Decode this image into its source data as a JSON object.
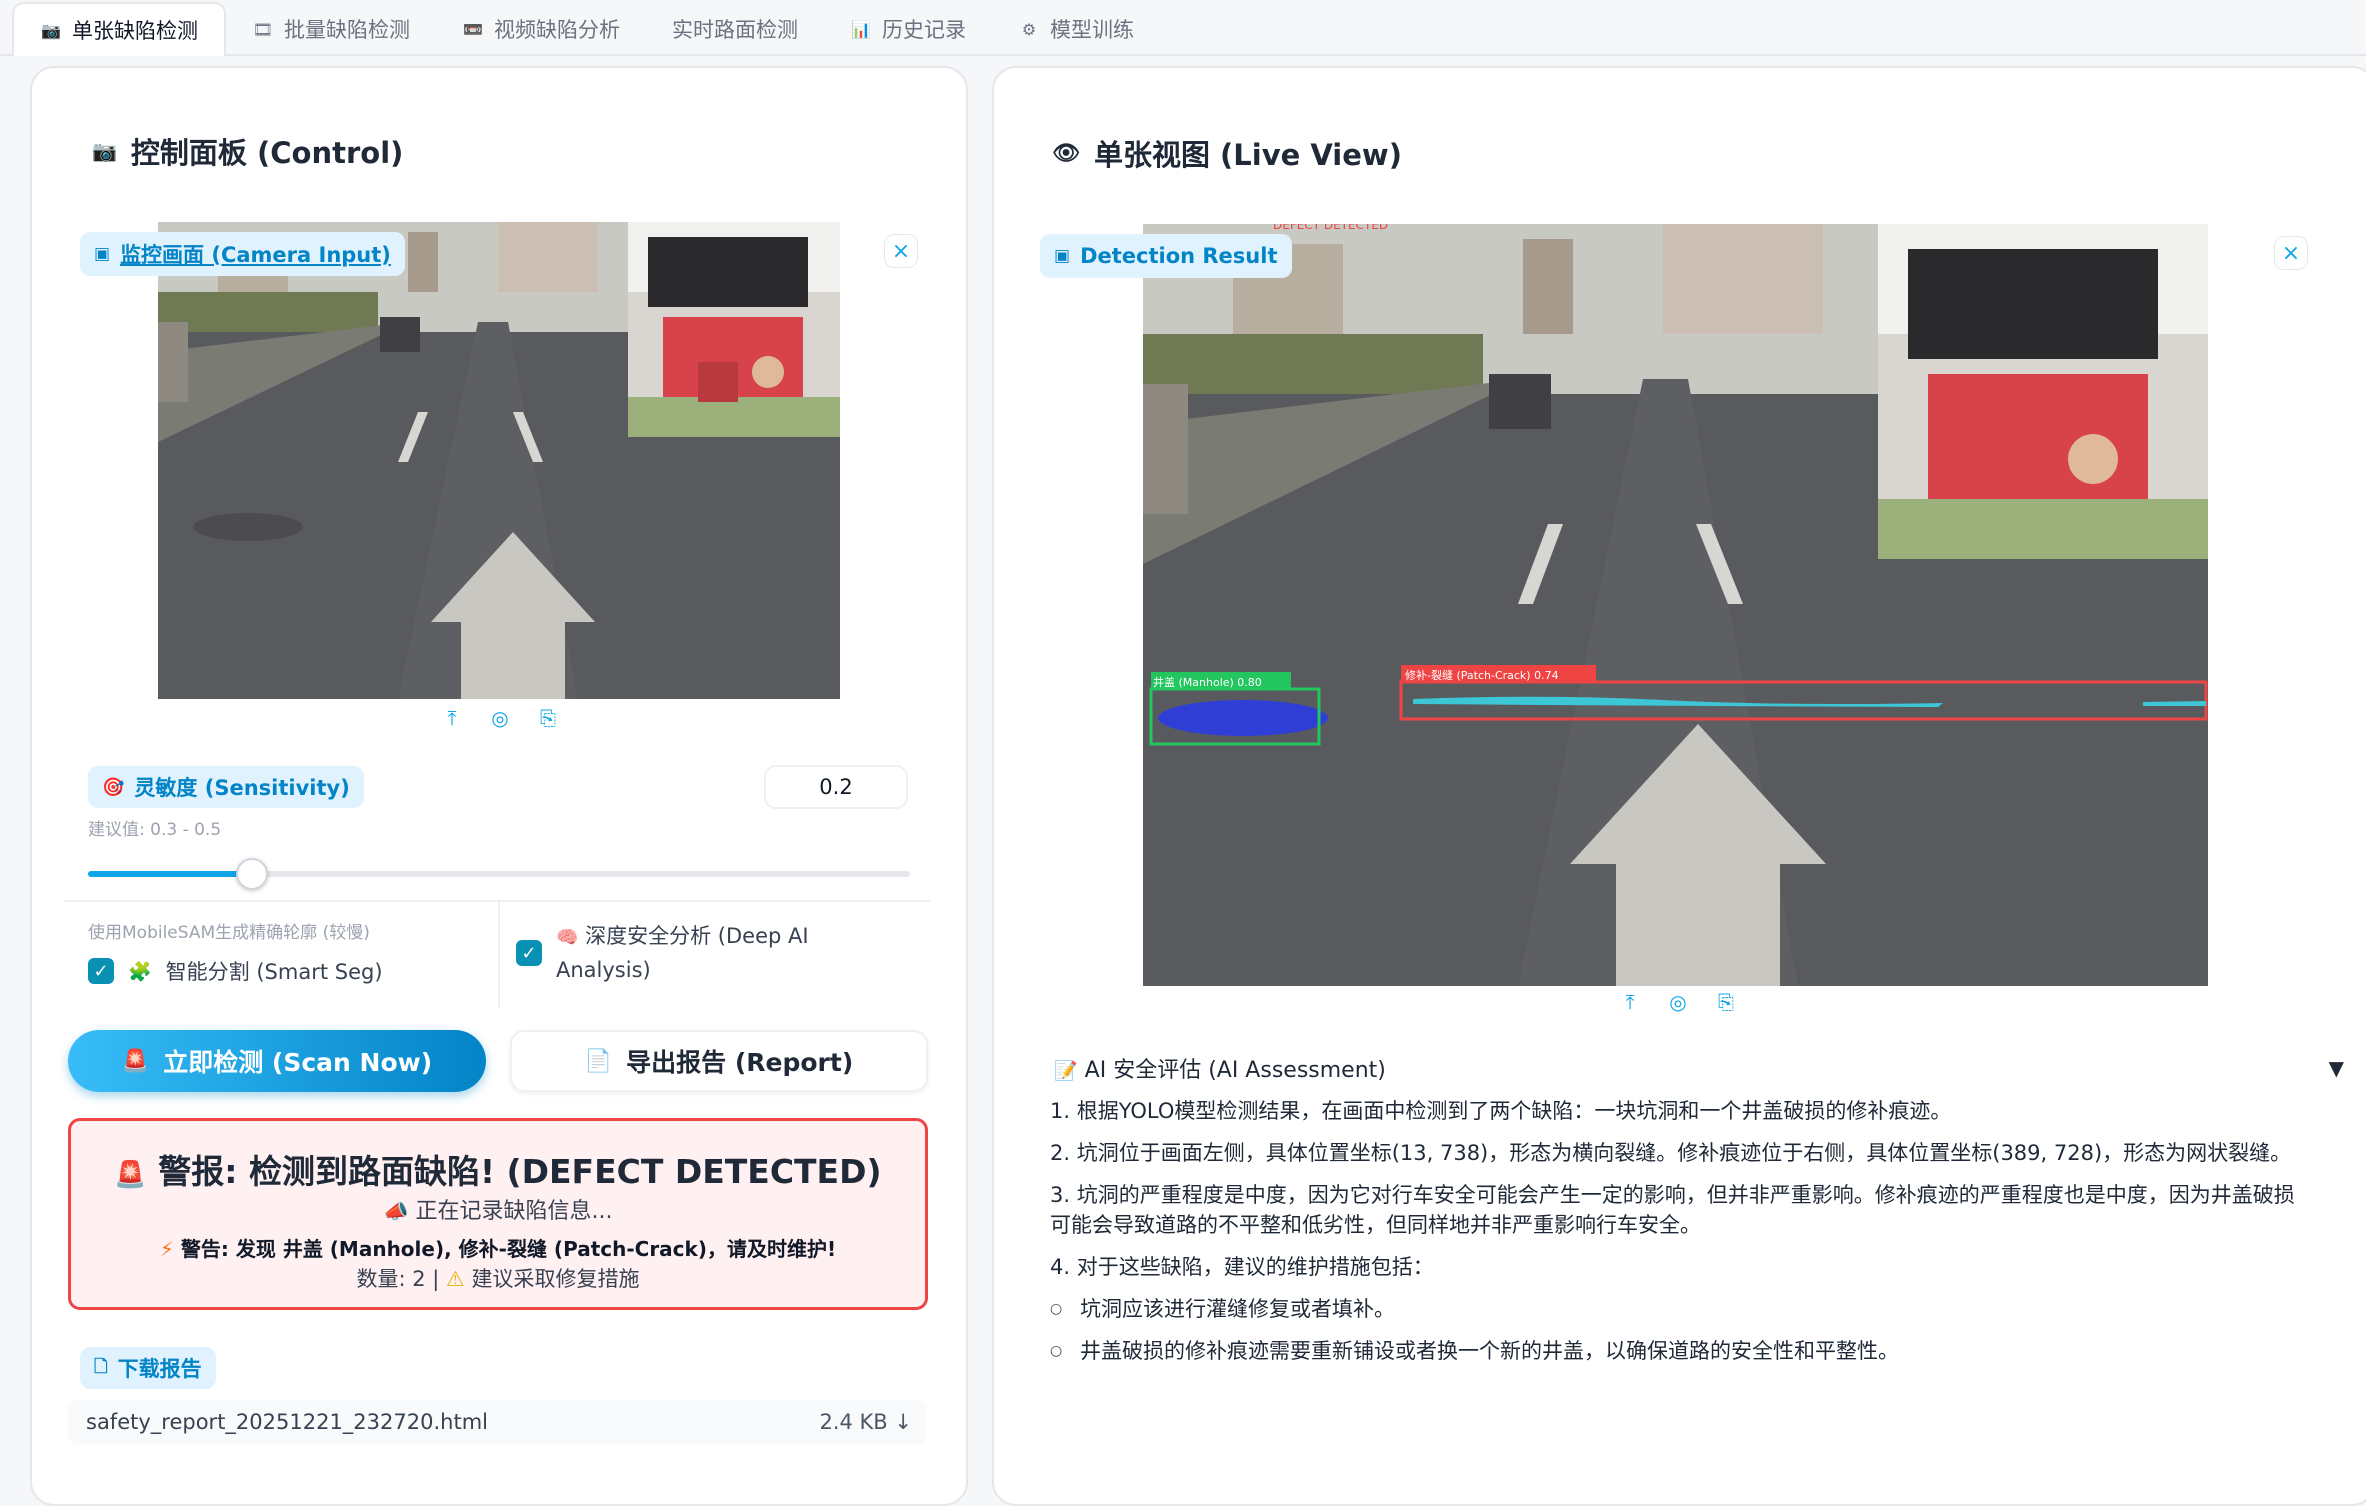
{
  "tabs": [
    {
      "icon": "camera-icon",
      "glyph": "📷",
      "label": "单张缺陷检测",
      "active": true
    },
    {
      "icon": "film-icon",
      "glyph": "🎞",
      "label": "批量缺陷检测",
      "active": false
    },
    {
      "icon": "video-icon",
      "glyph": "📼",
      "label": "视频缺陷分析",
      "active": false
    },
    {
      "icon": "none",
      "glyph": "",
      "label": "实时路面检测",
      "active": false
    },
    {
      "icon": "chart-icon",
      "glyph": "📊",
      "label": "历史记录",
      "active": false
    },
    {
      "icon": "gear-icon",
      "glyph": "⚙",
      "label": "模型训练",
      "active": false
    }
  ],
  "control": {
    "title": "控制面板 (Control)",
    "camera_label": "监控画面 (Camera Input)",
    "sensitivity_label": "灵敏度 (Sensitivity)",
    "sensitivity_value": "0.2",
    "sensitivity_fraction": 0.2,
    "sensitivity_hint": "建议值: 0.3 - 0.5",
    "smart_seg_info": "使用MobileSAM生成精确轮廓 (较慢)",
    "smart_seg_label": "智能分割 (Smart Seg)",
    "smart_seg_checked": true,
    "deep_ai_label": "深度安全分析 (Deep AI Analysis)",
    "deep_ai_line1": "深度安全分析 (Deep AI",
    "deep_ai_line2": "Analysis)",
    "deep_ai_checked": true,
    "scan_button": "立即检测 (Scan Now)",
    "report_button": "导出报告 (Report)",
    "alert": {
      "title": "警报: 检测到路面缺陷! (DEFECT DETECTED)",
      "recording": "正在记录缺陷信息...",
      "warning": "警告: 发现 井盖 (Manhole), 修补-裂缝 (Patch-Crack)，请及时维护!",
      "count_text": "数量: 2 |",
      "suggestion": "建议采取修复措施"
    },
    "download_label": "下载报告",
    "file_name": "safety_report_20251221_232720.html",
    "file_size": "2.4 KB ↓"
  },
  "live": {
    "title": "单张视图 (Live View)",
    "result_label": "Detection Result",
    "overlay_top_text": "DEFECT DETECTED",
    "detections": [
      {
        "label": "井盖 (Manhole) 0.80",
        "color": "#22c55e"
      },
      {
        "label": "修补-裂缝 (Patch-Crack) 0.74",
        "color": "#ef4444"
      }
    ],
    "assessment_title": "AI 安全评估 (AI Assessment)",
    "assessment_toggle": "▼",
    "assessment": [
      "1. 根据YOLO模型检测结果，在画面中检测到了两个缺陷：一块坑洞和一个井盖破损的修补痕迹。",
      "2. 坑洞位于画面左侧，具体位置坐标(13, 738)，形态为横向裂缝。修补痕迹位于右侧，具体位置坐标(389, 728)，形态为网状裂缝。",
      "3. 坑洞的严重程度是中度，因为它对行车安全可能会产生一定的影响，但并非严重影响。修补痕迹的严重程度也是中度，因为井盖破损可能会导致道路的不平整和低劣性，但同样地并非严重影响行车安全。",
      "4. 对于这些缺陷，建议的维护措施包括：",
      "坑洞应该进行灌缝修复或者填补。",
      "井盖破损的修补痕迹需要重新铺设或者换一个新的井盖，以确保道路的安全性和平整性。"
    ]
  },
  "colors": {
    "accent": "#0ea5e9",
    "alert_border": "#ef4444",
    "checkbox": "#0891b2"
  }
}
